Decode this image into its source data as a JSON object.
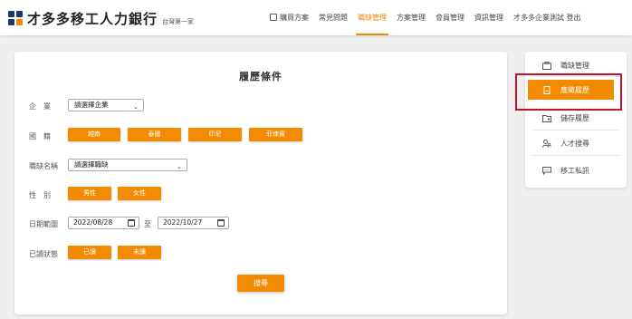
{
  "header": {
    "logo_title": "才多多移工人力銀行",
    "logo_sub": "台灣第一家",
    "nav": [
      {
        "label": "購買方案",
        "active": false,
        "icon": "cart-icon"
      },
      {
        "label": "常見問題",
        "active": false
      },
      {
        "label": "職缺管理",
        "active": true
      },
      {
        "label": "方案管理",
        "active": false
      },
      {
        "label": "會員管理",
        "active": false
      },
      {
        "label": "資訊管理",
        "active": false
      },
      {
        "label": "才多多企業測試 登出",
        "active": false
      }
    ]
  },
  "form": {
    "title": "履歷條件",
    "company": {
      "label": "企　業",
      "placeholder": "請選擇企業"
    },
    "nationality": {
      "label": "國　籍",
      "options": [
        "越南",
        "泰國",
        "印尼",
        "菲律賓"
      ]
    },
    "job": {
      "label": "職缺名稱",
      "placeholder": "請選擇職缺"
    },
    "gender": {
      "label": "性　別",
      "options": [
        "男性",
        "女性"
      ]
    },
    "date_range": {
      "label": "日期範圍",
      "start": "2022/08/28",
      "separator": "至",
      "end": "2022/10/27"
    },
    "read_status": {
      "label": "已讀狀態",
      "options": [
        "已讀",
        "未讀"
      ]
    },
    "search_button": "搜尋"
  },
  "sidebar": {
    "items": [
      {
        "label": "職缺管理",
        "icon": "briefcase-icon",
        "active": false
      },
      {
        "label": "應徵履歷",
        "icon": "document-icon",
        "active": true
      },
      {
        "label": "儲存履歷",
        "icon": "folder-icon",
        "active": false
      },
      {
        "label": "人才搜尋",
        "icon": "person-search-icon",
        "active": false
      },
      {
        "label": "移工私訊",
        "icon": "chat-icon",
        "active": false
      }
    ]
  },
  "colors": {
    "accent": "#f28b00",
    "highlight": "#c8102e",
    "logo_blue": "#1f3a68",
    "logo_orange": "#f28b00"
  }
}
